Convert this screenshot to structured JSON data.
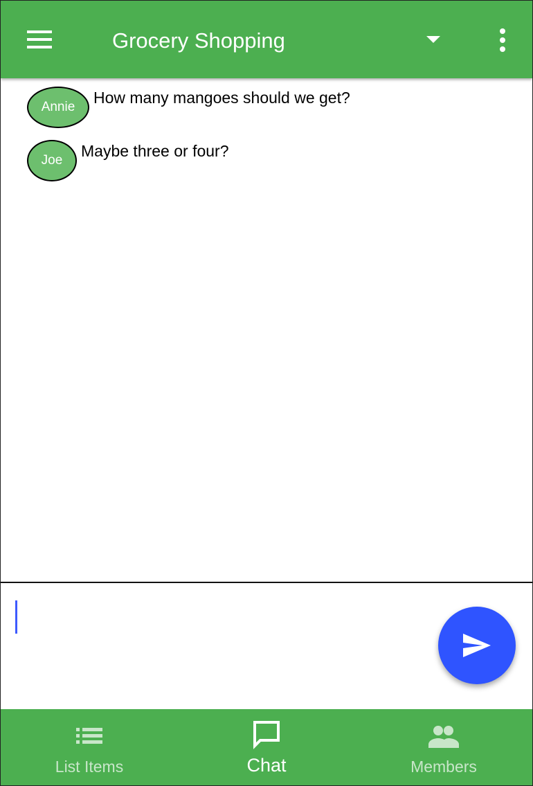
{
  "app_bar": {
    "title": "Grocery Shopping",
    "menu_icon": "hamburger-menu-icon",
    "dropdown_icon": "arrow-drop-down-icon",
    "more_icon": "more-vert-icon",
    "background_color": "#4caf50"
  },
  "messages": [
    {
      "author": "Annie",
      "text": "How many mangoes should we get?"
    },
    {
      "author": "Joe",
      "text": "Maybe three or four?"
    }
  ],
  "avatar_color": "#6dbf6e",
  "composer": {
    "input_value": "",
    "send_icon": "send-icon",
    "send_button_color": "#2f54ff"
  },
  "bottom_nav": {
    "items": [
      {
        "label": "List Items",
        "icon": "list-icon",
        "active": false
      },
      {
        "label": "Chat",
        "icon": "chat-bubble-icon",
        "active": true
      },
      {
        "label": "Members",
        "icon": "people-icon",
        "active": false
      }
    ]
  }
}
